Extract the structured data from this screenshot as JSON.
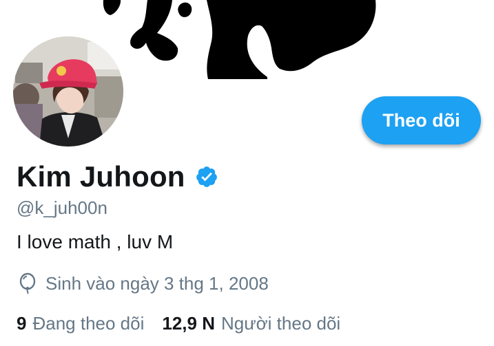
{
  "profile": {
    "name": "Kim Juhoon",
    "handle": "@k_juh00n",
    "bio": "I love math , luv M",
    "birth": "Sinh vào ngày 3 thg 1, 2008",
    "verified": true
  },
  "actions": {
    "follow_label": "Theo dõi"
  },
  "stats": {
    "following_count": "9",
    "following_label": "Đang theo dõi",
    "followers_count": "12,9 N",
    "followers_label": "Người theo dõi"
  },
  "icons": {
    "verified": "verified-badge-icon",
    "birthday": "balloon-icon"
  },
  "colors": {
    "accent": "#1da1f2",
    "text": "#14171a",
    "muted": "#657786"
  }
}
